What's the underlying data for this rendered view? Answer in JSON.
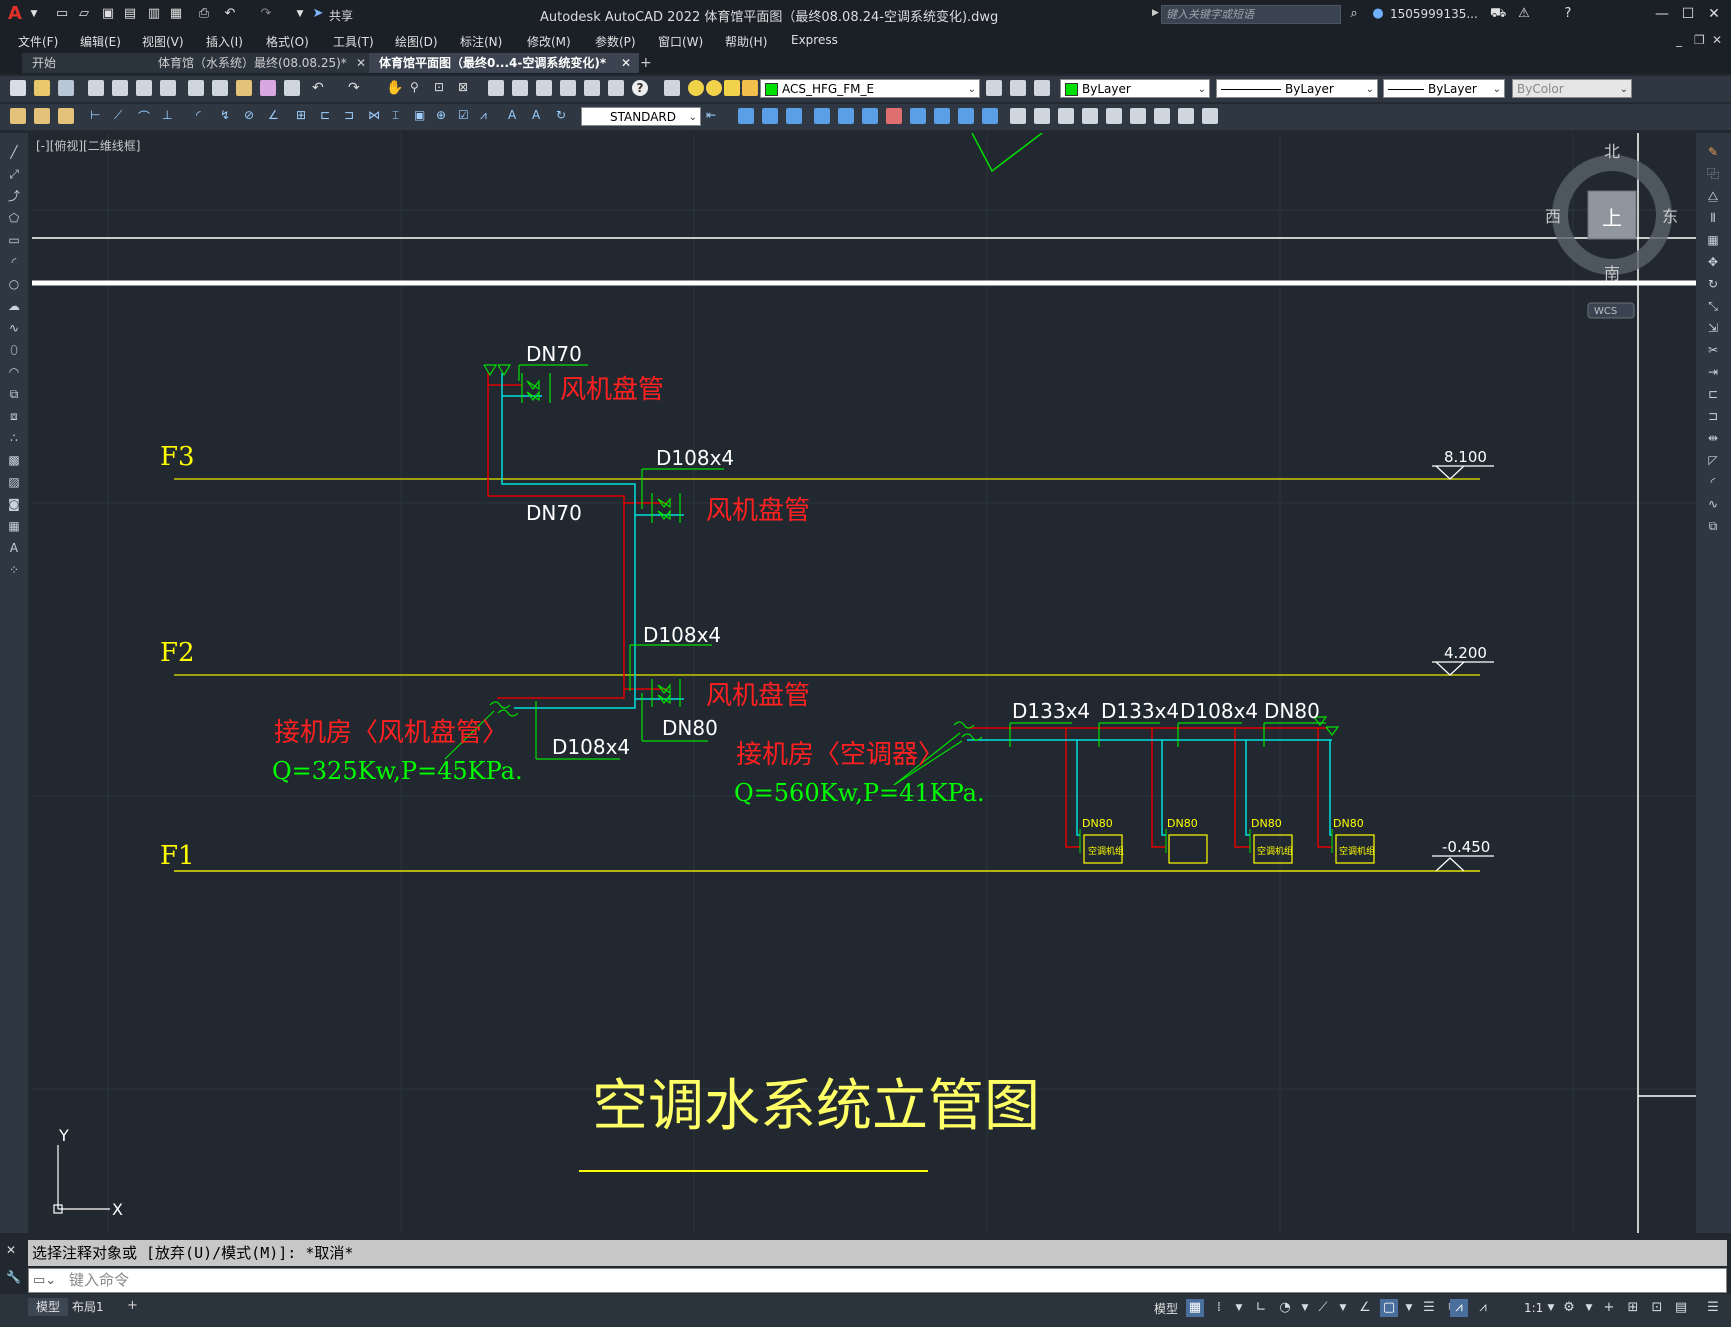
{
  "app": {
    "logo": "A",
    "window_title": "Autodesk AutoCAD 2022    体育馆平面图（最终08.08.24-空调系统变化).dwg",
    "share_label": "共享",
    "search_placeholder": "键入关键字或短语",
    "user_label": "1505999135..."
  },
  "menubar": [
    "文件(F)",
    "编辑(E)",
    "视图(V)",
    "插入(I)",
    "格式(O)",
    "工具(T)",
    "绘图(D)",
    "标注(N)",
    "修改(M)",
    "参数(P)",
    "窗口(W)",
    "帮助(H)",
    "Express"
  ],
  "tabs": [
    {
      "label": "开始"
    },
    {
      "label": "体育馆（水系统）最终(08.08.25)*"
    },
    {
      "label": "体育馆平面图（最终0...4-空调系统变化)*"
    }
  ],
  "toolbar": {
    "layer": "ACS_HFG_FM_E",
    "color": "ByLayer",
    "linetype": "ByLayer",
    "lineweight": "ByLayer",
    "plotstyle": "ByColor",
    "textstyle": "STANDARD"
  },
  "viewport_label": "[-][俯视][二维线框]",
  "viewcube": {
    "north": "北",
    "south": "南",
    "east": "东",
    "west": "西",
    "top": "上",
    "wcs": "WCS"
  },
  "drawing": {
    "floors": [
      {
        "name": "F3",
        "elev": "8.100"
      },
      {
        "name": "F2",
        "elev": "4.200"
      },
      {
        "name": "F1",
        "elev": "-0.450"
      }
    ],
    "labels": {
      "dn70_top": "DN70",
      "dn70_mid": "DN70",
      "fcu1": "风机盘管",
      "fcu2": "风机盘管",
      "fcu3": "风机盘管",
      "d108_1": "D108x4",
      "d108_2": "D108x4",
      "d108_3": "D108x4",
      "dn80_left": "DN80",
      "room_left": "接机房〈风机盘管〉",
      "q_left": "Q=325Kw,P=45KPa.",
      "room_right": "接机房〈空调器〉",
      "q_right": "Q=560Kw,P=41KPa.",
      "d133_1": "D133x4",
      "d133_2": "D133x4",
      "d108_4": "D108x4",
      "dn80_right": "DN80",
      "unit_dn80": "DN80",
      "unit_label": "空调机组",
      "main_title": "空调水系统立管图"
    },
    "ucs_x": "X",
    "ucs_y": "Y"
  },
  "command": {
    "history": "选择注释对象或 [放弃(U)/模式(M)]: *取消*",
    "placeholder": "键入命令"
  },
  "status": {
    "model_tab": "模型",
    "layout_tab": "布局1",
    "model_button": "模型",
    "scale": "1:1"
  }
}
